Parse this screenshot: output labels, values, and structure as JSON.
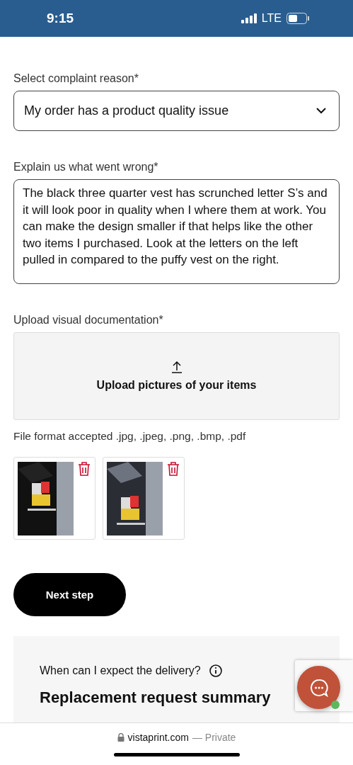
{
  "status_bar": {
    "time": "9:15",
    "network": "LTE"
  },
  "complaint_reason": {
    "label": "Select complaint reason*",
    "value": "My order has a product quality issue"
  },
  "explanation": {
    "label": "Explain us what went wrong*",
    "value": "The black three quarter vest has scrunched letter S’s and it will look poor in quality when I where them at work. You can make the design smaller if that helps like the other two items I purchased. Look at the letters on the left pulled in compared to the puffy vest on the right."
  },
  "upload": {
    "label": "Upload visual documentation*",
    "button": "Upload pictures of your items",
    "formats": "File format accepted .jpg, .jpeg, .png, .bmp, .pdf"
  },
  "next_button": "Next step",
  "summary": {
    "question": "When can I expect the delivery?",
    "title": "Replacement request summary"
  },
  "browser_bar": {
    "domain": "vistaprint.com",
    "mode": "— Private"
  }
}
